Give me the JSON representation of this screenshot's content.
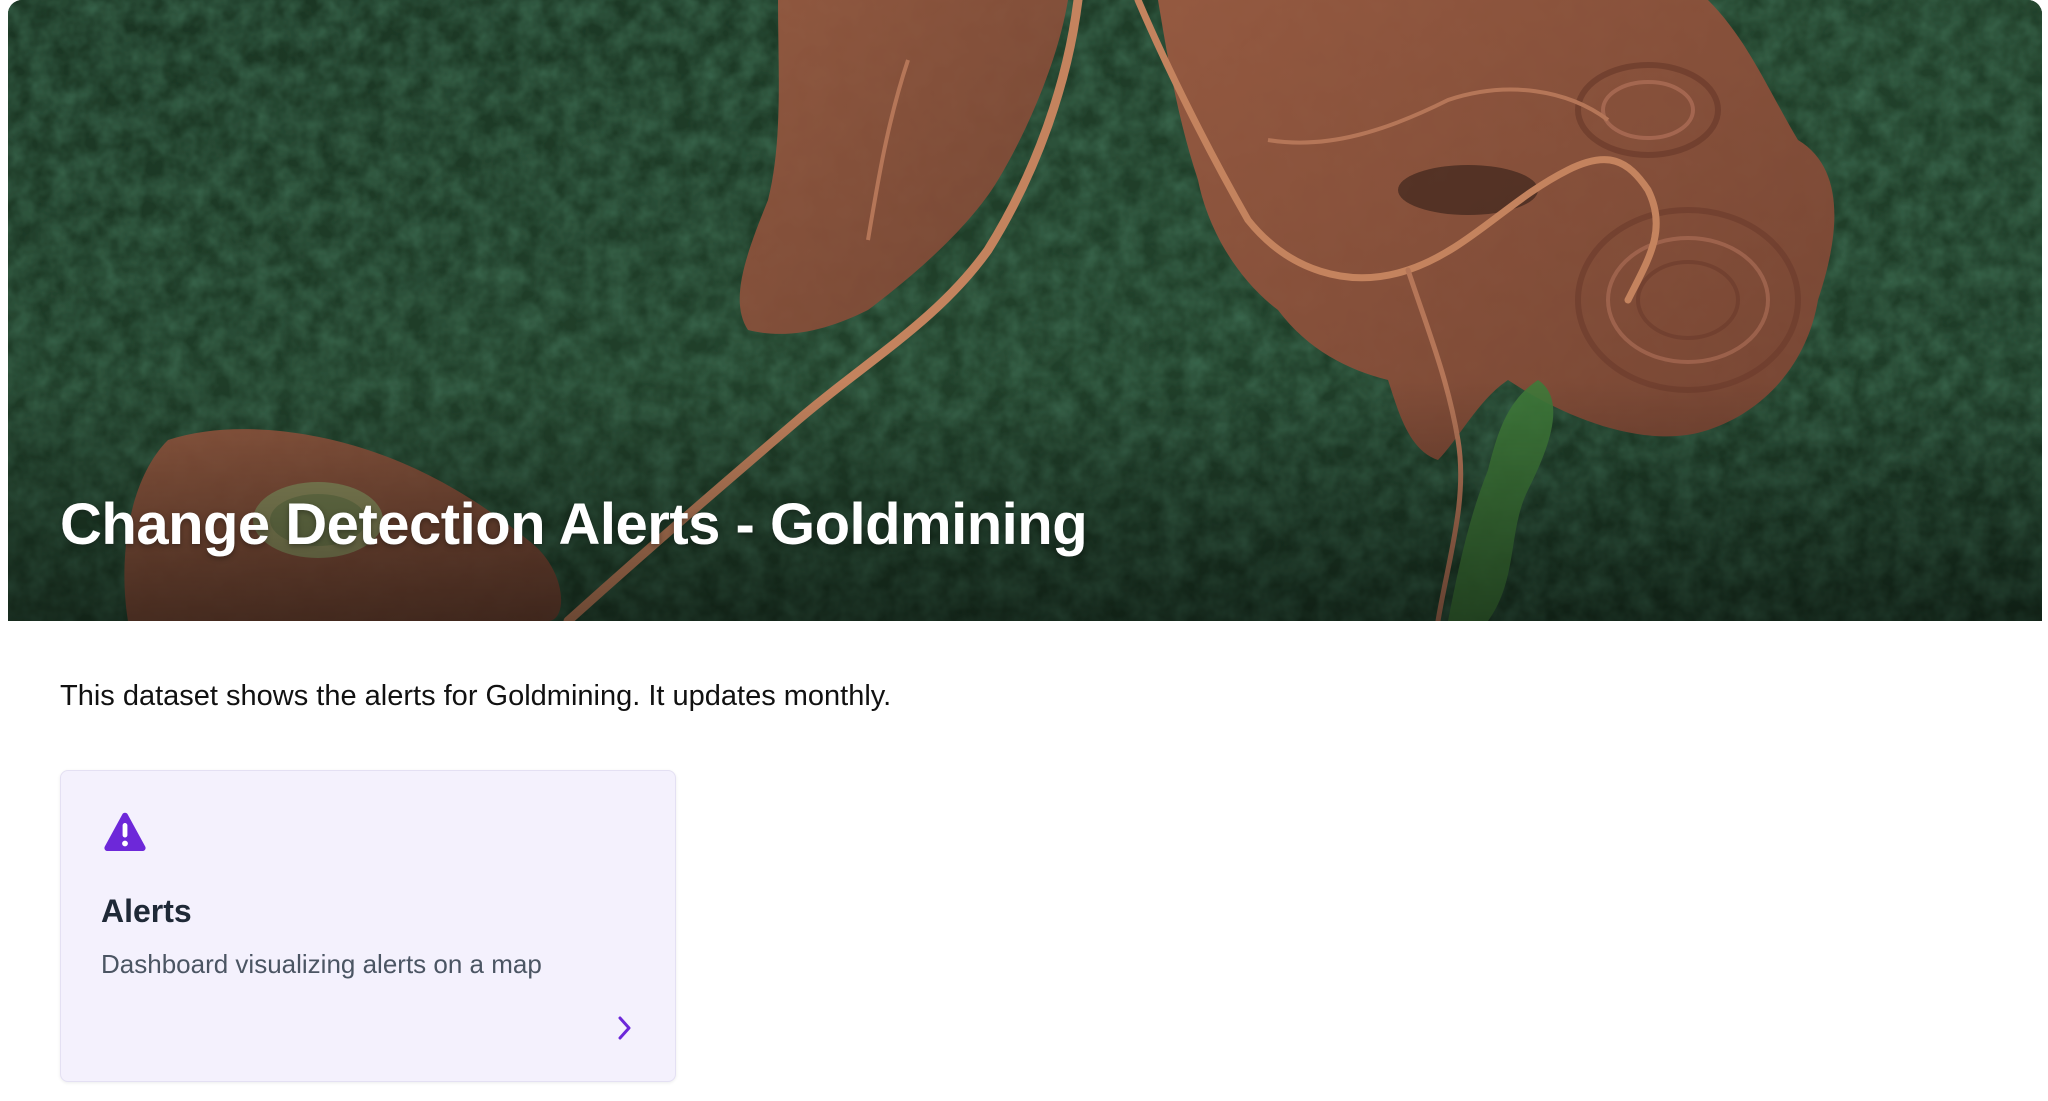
{
  "hero": {
    "title": "Change Detection Alerts - Goldmining"
  },
  "description": "This dataset shows the alerts for Goldmining. It updates monthly.",
  "cards": [
    {
      "title": "Alerts",
      "description": "Dashboard visualizing alerts on a map",
      "icon": "warning-triangle-icon",
      "action_icon": "chevron-right-icon"
    }
  ],
  "colors": {
    "accent": "#6d28d9",
    "card_background": "#f4f1fd",
    "forest": "#1d3a26",
    "mine_soil": "#8a4f38"
  }
}
